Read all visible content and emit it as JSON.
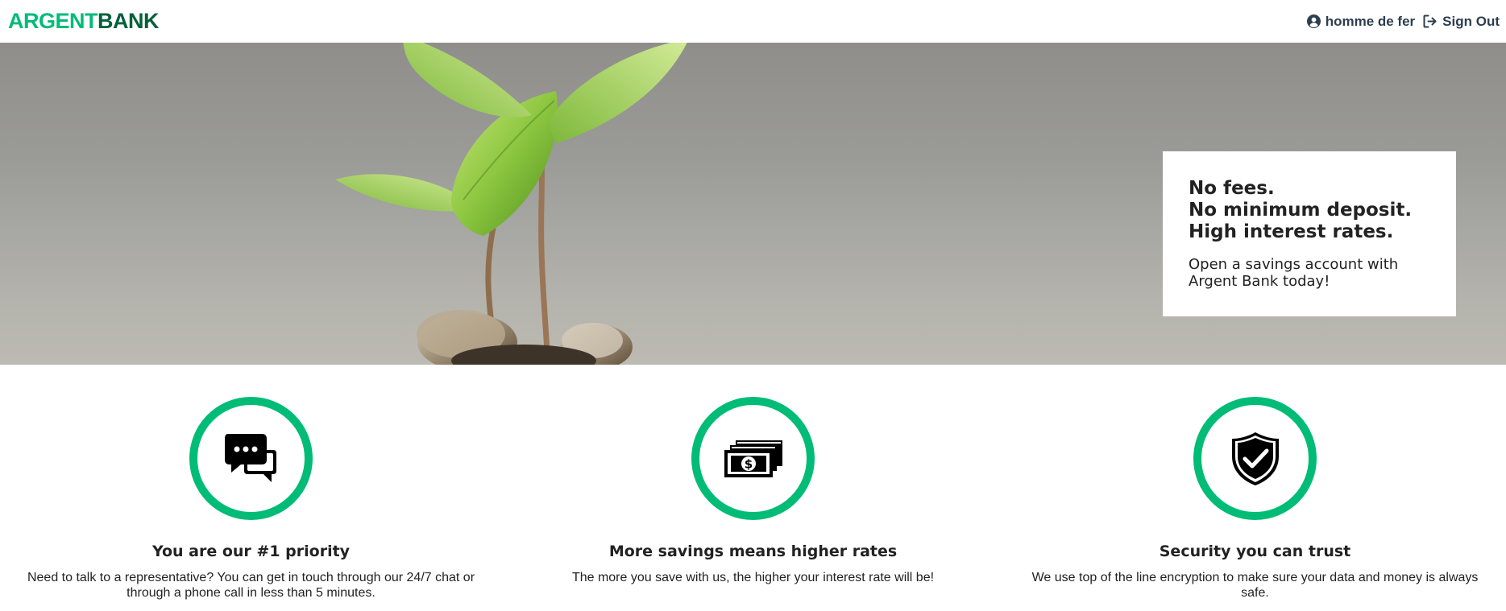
{
  "nav": {
    "logo_part1": "ARGENT",
    "logo_part2": "BANK",
    "user_name": "homme de fer",
    "sign_out_label": "Sign Out",
    "user_icon": "user-circle-icon",
    "sign_out_icon": "sign-out-icon"
  },
  "hero": {
    "subtitles": [
      "No fees.",
      "No minimum deposit.",
      "High interest rates."
    ],
    "text": "Open a savings account with Argent Bank today!"
  },
  "features": [
    {
      "icon": "chat-icon",
      "title": "You are our #1 priority",
      "text": "Need to talk to a representative? You can get in touch through our 24/7 chat or through a phone call in less than 5 minutes."
    },
    {
      "icon": "money-icon",
      "title": "More savings means higher rates",
      "text": "The more you save with us, the higher your interest rate will be!"
    },
    {
      "icon": "security-icon",
      "title": "Security you can trust",
      "text": "We use top of the line encryption to make sure your data and money is always safe."
    }
  ],
  "colors": {
    "accent": "#00bc77",
    "logo_dark": "#05603b",
    "text": "#2c3e50"
  }
}
